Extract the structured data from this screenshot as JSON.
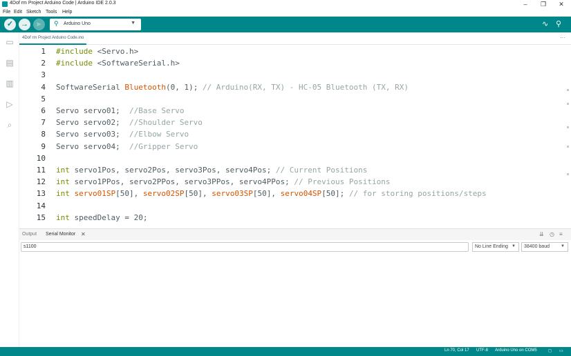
{
  "window": {
    "title": "4Dof rm Project Arduino Code | Arduino IDE 2.0.3",
    "minimize": "–",
    "maximize": "❐",
    "close": "✕"
  },
  "menu": [
    "File",
    "Edit",
    "Sketch",
    "Tools",
    "Help"
  ],
  "toolbar": {
    "board": "Arduino Uno",
    "accent": "#00878a"
  },
  "tab": {
    "filename": "4Dof rm Project Arduino Code.ino",
    "more": "···"
  },
  "code_lines": [
    {
      "n": "1",
      "parts": [
        [
          "dir",
          "#include"
        ],
        [
          "",
          " <Servo.h>"
        ]
      ]
    },
    {
      "n": "2",
      "parts": [
        [
          "dir",
          "#include"
        ],
        [
          "",
          " <SoftwareSerial.h>"
        ]
      ]
    },
    {
      "n": "3",
      "parts": []
    },
    {
      "n": "4",
      "parts": [
        [
          "",
          "SoftwareSerial "
        ],
        [
          "fn",
          "Bluetooth"
        ],
        [
          "",
          "(0, 1); "
        ],
        [
          "cm",
          "// Arduino(RX, TX) - HC-05 Bluetooth (TX, RX)"
        ]
      ]
    },
    {
      "n": "5",
      "parts": []
    },
    {
      "n": "6",
      "parts": [
        [
          "",
          "Servo servo01;  "
        ],
        [
          "cm",
          "//Base Servo"
        ]
      ]
    },
    {
      "n": "7",
      "parts": [
        [
          "",
          "Servo servo02;  "
        ],
        [
          "cm",
          "//Shoulder Servo"
        ]
      ]
    },
    {
      "n": "8",
      "parts": [
        [
          "",
          "Servo servo03;  "
        ],
        [
          "cm",
          "//Elbow Servo"
        ]
      ]
    },
    {
      "n": "9",
      "parts": [
        [
          "",
          "Servo servo04;  "
        ],
        [
          "cm",
          "//Gripper Servo"
        ]
      ]
    },
    {
      "n": "10",
      "parts": []
    },
    {
      "n": "11",
      "parts": [
        [
          "kw",
          "int"
        ],
        [
          "",
          " servo1Pos, servo2Pos, servo3Pos, servo4Pos; "
        ],
        [
          "cm",
          "// Current Positions"
        ]
      ]
    },
    {
      "n": "12",
      "parts": [
        [
          "kw",
          "int"
        ],
        [
          "",
          " servo1PPos, servo2PPos, servo3PPos, servo4PPos; "
        ],
        [
          "cm",
          "// Previous Positions"
        ]
      ]
    },
    {
      "n": "13",
      "parts": [
        [
          "kw",
          "int"
        ],
        [
          "",
          " "
        ],
        [
          "fn",
          "servo01SP"
        ],
        [
          "",
          "[50], "
        ],
        [
          "fn",
          "servo02SP"
        ],
        [
          "",
          "[50], "
        ],
        [
          "fn",
          "servo03SP"
        ],
        [
          "",
          "[50], "
        ],
        [
          "fn",
          "servo04SP"
        ],
        [
          "",
          "[50]; "
        ],
        [
          "cm",
          "// for storing positions/steps"
        ]
      ]
    },
    {
      "n": "14",
      "parts": []
    },
    {
      "n": "15",
      "parts": [
        [
          "kw",
          "int"
        ],
        [
          "",
          " speedDelay = 20;"
        ]
      ]
    }
  ],
  "panel": {
    "output_tab": "Output",
    "serial_tab": "Serial Monitor",
    "input_value": "s1100",
    "line_ending": "No Line Ending",
    "baud": "38400 baud"
  },
  "status": {
    "position": "Ln 70, Col 17",
    "encoding": "UTF-8",
    "board_port": "Arduino Uno on COM5"
  }
}
